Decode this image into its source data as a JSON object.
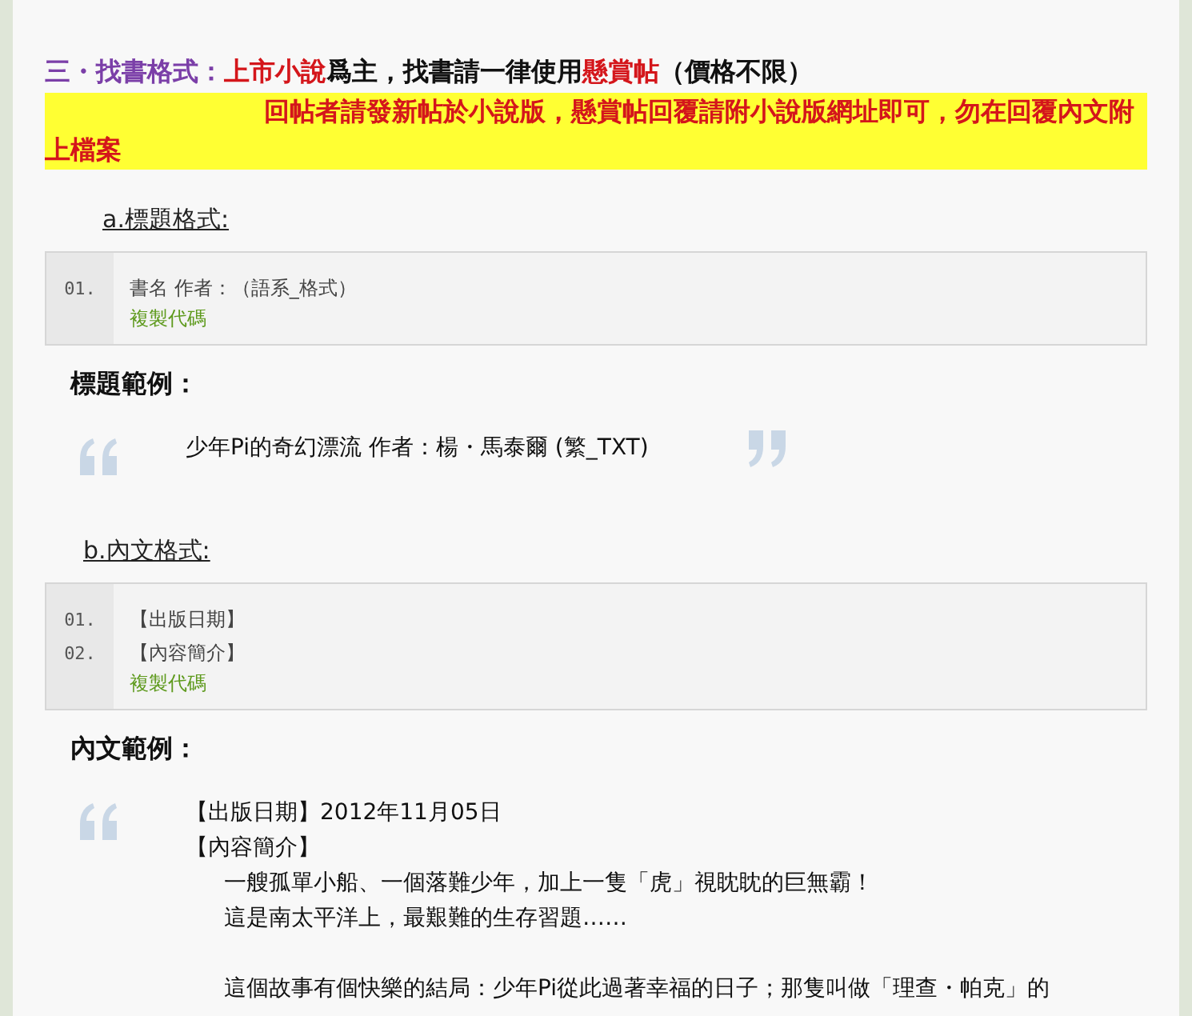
{
  "heading": {
    "segments": [
      {
        "kind": "label",
        "text": "三・找書格式："
      },
      {
        "kind": "emphasis",
        "text": "上市小說"
      },
      {
        "kind": "plain",
        "text": "爲主，找書請一律使用"
      },
      {
        "kind": "emphasis",
        "text": "懸賞帖"
      },
      {
        "kind": "plain",
        "text": "（價格不限）"
      }
    ]
  },
  "notice": "回帖者請發新帖於小說版，懸賞帖回覆請附小說版網址即可，勿在回覆內文附上檔案",
  "sections": [
    {
      "subtitle": "a.標題格式:",
      "code_lines": [
        {
          "number": "01.",
          "text": "書名 作者：（語系_格式）"
        }
      ],
      "copy_link": "複製代碼",
      "example_title": "標題範例：",
      "example_lines": [
        {
          "kind": "line",
          "text": "少年Pi的奇幻漂流 作者：楊・馬泰爾 (繁_TXT)"
        }
      ],
      "closing_quote": true
    },
    {
      "subtitle": "b.內文格式:",
      "code_lines": [
        {
          "number": "01.",
          "text": "【出版日期】"
        },
        {
          "number": "02.",
          "text": "【內容簡介】"
        }
      ],
      "copy_link": "複製代碼",
      "example_title": "內文範例：",
      "example_lines": [
        {
          "kind": "line",
          "text": "【出版日期】2012年11月05日"
        },
        {
          "kind": "line",
          "text": "【內容簡介】"
        },
        {
          "kind": "indent",
          "text": "一艘孤單小船、一個落難少年，加上一隻「虎」視眈眈的巨無霸！"
        },
        {
          "kind": "indent",
          "text": "這是南太平洋上，最艱難的生存習題……"
        },
        {
          "kind": "blank"
        },
        {
          "kind": "indent",
          "text": "這個故事有個快樂的結局：少年Pi從此過著幸福的日子；那隻叫做「理查・帕克」的"
        }
      ],
      "closing_quote": false
    }
  ]
}
